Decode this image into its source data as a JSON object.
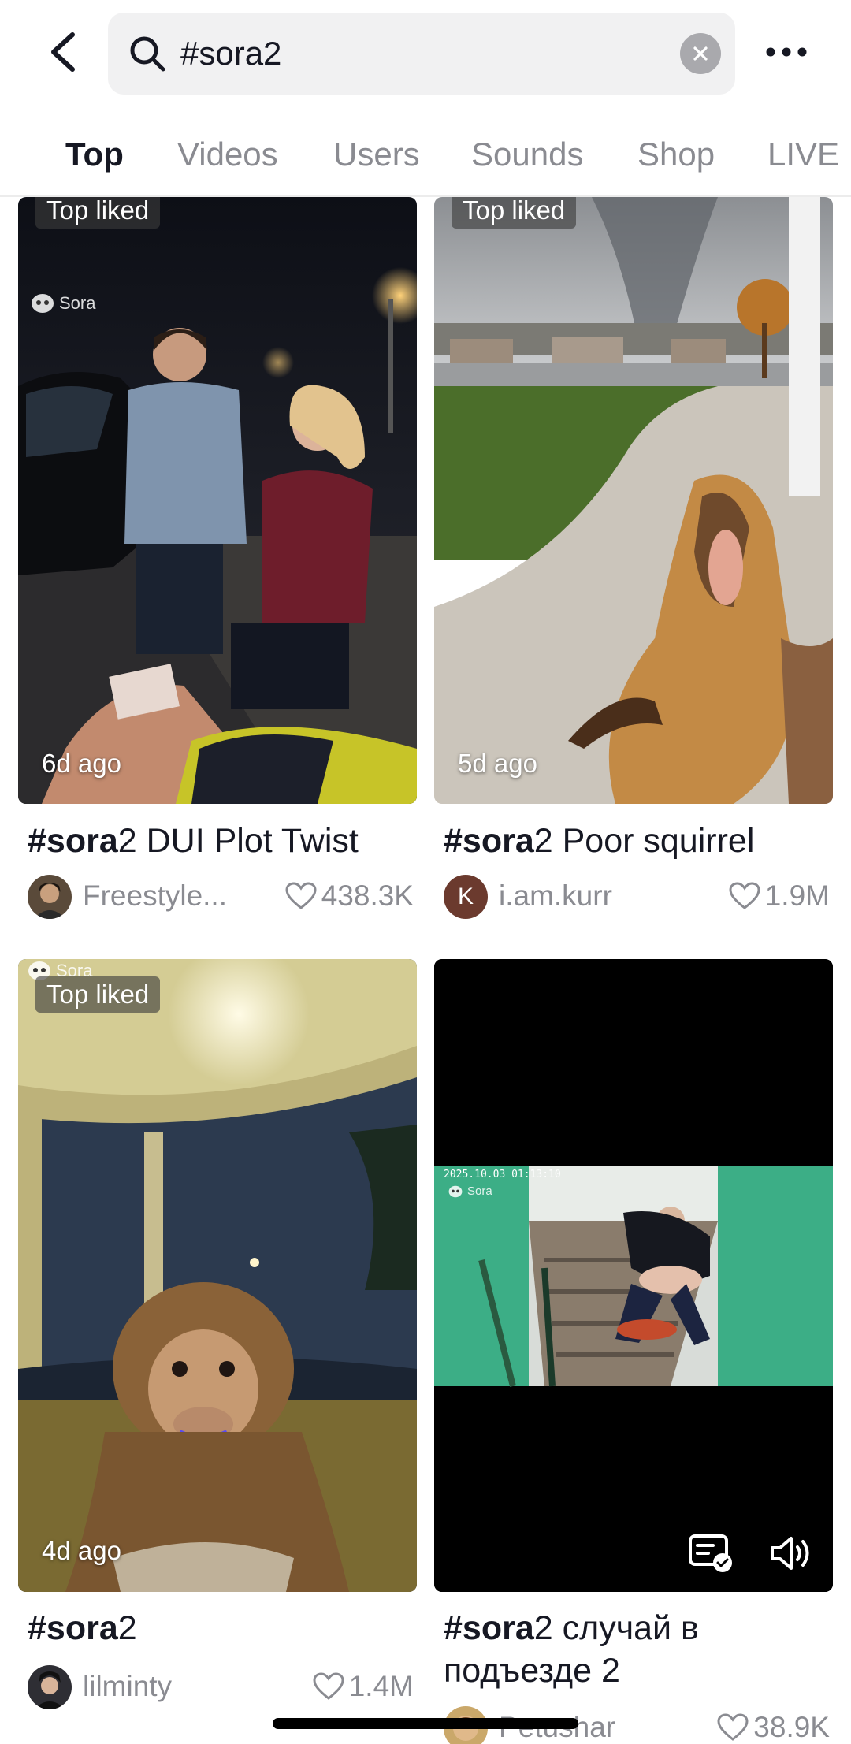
{
  "search": {
    "query": "#sora2"
  },
  "tabs": [
    {
      "label": "Top"
    },
    {
      "label": "Videos"
    },
    {
      "label": "Users"
    },
    {
      "label": "Sounds"
    },
    {
      "label": "Shop"
    },
    {
      "label": "LIVE"
    }
  ],
  "results": [
    {
      "badge": "Top liked",
      "watermark": "Sora",
      "ago": "6d ago",
      "title_tag": "#sora",
      "title_rest": "2 DUI Plot Twist",
      "username": "Freestyle...",
      "likes": "438.3K"
    },
    {
      "badge": "Top liked",
      "ago": "5d ago",
      "title_tag": "#sora",
      "title_rest": "2 Poor squirrel",
      "avatar_letter": "K",
      "username": "i.am.kurr",
      "likes": "1.9M"
    },
    {
      "badge": "Top liked",
      "watermark": "Sora",
      "ago": "4d ago",
      "title_tag": "#sora",
      "title_rest": "2",
      "username": "lilminty",
      "likes": "1.4M"
    },
    {
      "cctv_stamp": "2025.10.03 01:13:10",
      "watermark": "Sora",
      "title_tag": "#sora",
      "title_rest": "2 случай в подъезде 2",
      "username": "Petushar",
      "likes": "38.9K"
    }
  ],
  "colors": {
    "text": "#161823",
    "muted": "#8a8b91",
    "search_bg": "#f1f1f2",
    "badge_bg": "rgba(60,60,60,0.62)"
  }
}
